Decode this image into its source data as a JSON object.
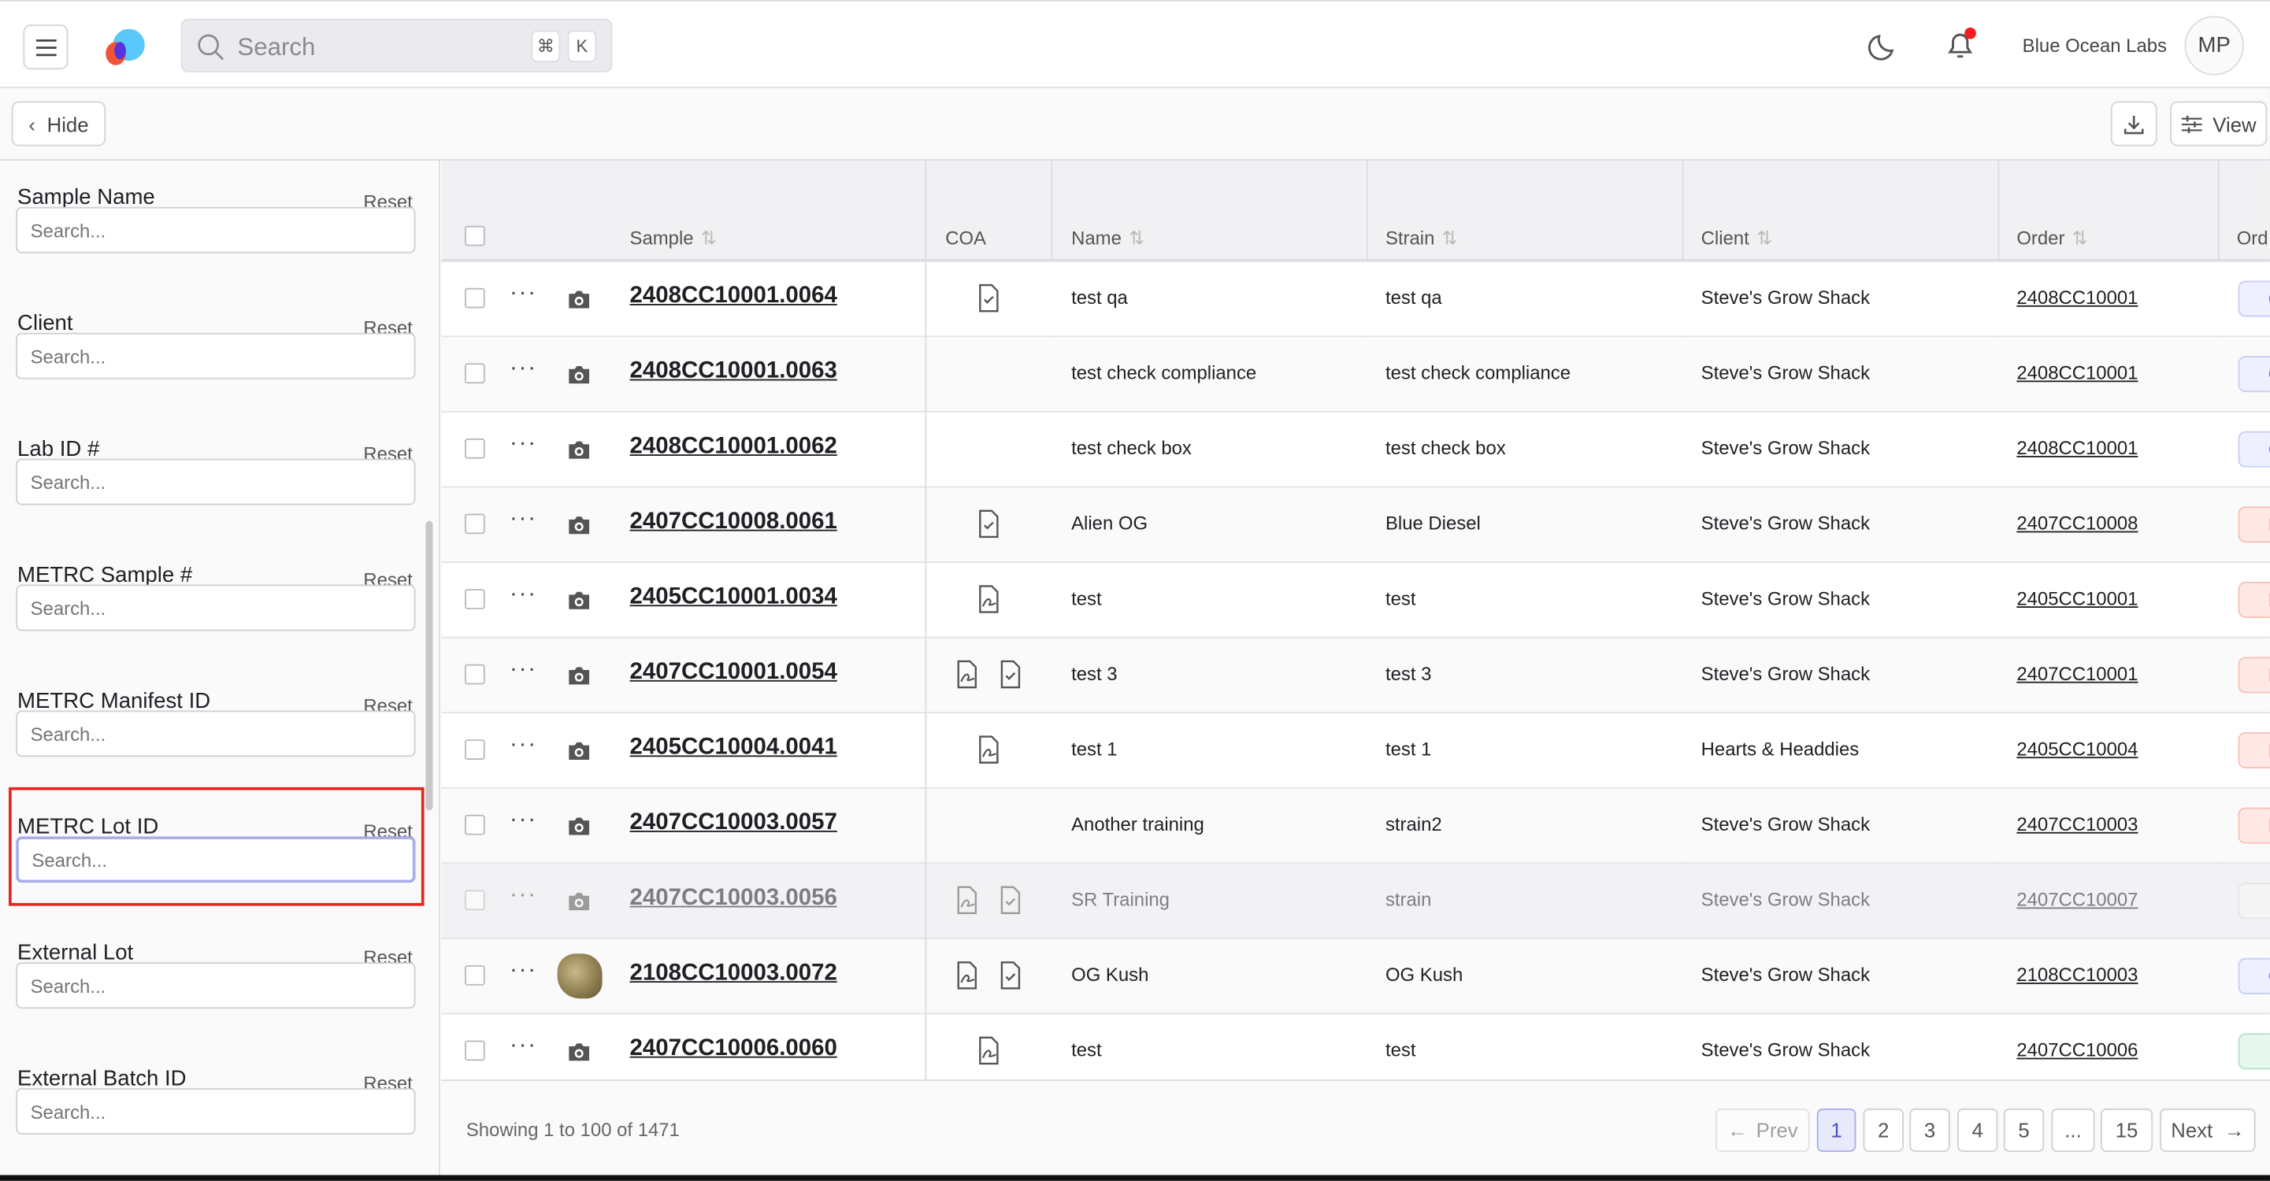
{
  "header": {
    "search_placeholder": "Search",
    "kbd_cmd": "⌘",
    "kbd_k": "K",
    "org_name": "Blue Ocean Labs",
    "avatar_initials": "MP",
    "notification_dot_color": "#f01e1e"
  },
  "toolbar": {
    "hide_label": "Hide",
    "view_label": "View"
  },
  "filters": [
    {
      "label": "Sample Name",
      "reset": "Reset",
      "placeholder": "Search..."
    },
    {
      "label": "Client",
      "reset": "Reset",
      "placeholder": "Search..."
    },
    {
      "label": "Lab ID #",
      "reset": "Reset",
      "placeholder": "Search..."
    },
    {
      "label": "METRC Sample #",
      "reset": "Reset",
      "placeholder": "Search..."
    },
    {
      "label": "METRC Manifest ID",
      "reset": "Reset",
      "placeholder": "Search..."
    },
    {
      "label": "METRC Lot ID",
      "reset": "Reset",
      "placeholder": "Search...",
      "focused": true,
      "highlighted": true
    },
    {
      "label": "External Lot",
      "reset": "Reset",
      "placeholder": "Search..."
    },
    {
      "label": "External Batch ID",
      "reset": "Reset",
      "placeholder": "Search..."
    }
  ],
  "table": {
    "columns": {
      "sample": "Sample",
      "coa": "COA",
      "name": "Name",
      "strain": "Strain",
      "client": "Client",
      "order": "Order",
      "order_status": "Ord"
    },
    "rows": [
      {
        "sample": "2408CC10001.0064",
        "coa": [
          "check"
        ],
        "name": "test qa",
        "strain": "test qa",
        "client": "Steve's Grow Shack",
        "order": "2408CC10001",
        "status": "blue",
        "status_text": "C"
      },
      {
        "sample": "2408CC10001.0063",
        "coa": [],
        "name": "test check compliance",
        "strain": "test check compliance",
        "client": "Steve's Grow Shack",
        "order": "2408CC10001",
        "status": "blue",
        "status_text": "C"
      },
      {
        "sample": "2408CC10001.0062",
        "coa": [],
        "name": "test check box",
        "strain": "test check box",
        "client": "Steve's Grow Shack",
        "order": "2408CC10001",
        "status": "blue",
        "status_text": "C"
      },
      {
        "sample": "2407CC10008.0061",
        "coa": [
          "check"
        ],
        "name": "Alien OG",
        "strain": "Blue Diesel",
        "client": "Steve's Grow Shack",
        "order": "2407CC10008",
        "status": "red",
        "status_text": "I"
      },
      {
        "sample": "2405CC10001.0034",
        "coa": [
          "sign"
        ],
        "name": "test",
        "strain": "test",
        "client": "Steve's Grow Shack",
        "order": "2405CC10001",
        "status": "red",
        "status_text": "I"
      },
      {
        "sample": "2407CC10001.0054",
        "coa": [
          "sign",
          "check"
        ],
        "name": "test 3",
        "strain": "test 3",
        "client": "Steve's Grow Shack",
        "order": "2407CC10001",
        "status": "red",
        "status_text": "I"
      },
      {
        "sample": "2405CC10004.0041",
        "coa": [
          "sign"
        ],
        "name": "test 1",
        "strain": "test 1",
        "client": "Hearts & Headdies",
        "order": "2405CC10004",
        "status": "red",
        "status_text": "I"
      },
      {
        "sample": "2407CC10003.0057",
        "coa": [],
        "name": "Another training",
        "strain": "strain2",
        "client": "Steve's Grow Shack",
        "order": "2407CC10003",
        "status": "red",
        "status_text": "I"
      },
      {
        "sample": "2407CC10003.0056",
        "coa": [
          "sign",
          "check"
        ],
        "name": "SR Training",
        "strain": "strain",
        "client": "Steve's Grow Shack",
        "order": "2407CC10007",
        "status": "grey",
        "status_text": "",
        "disabled": true
      },
      {
        "sample": "2108CC10003.0072",
        "coa": [
          "sign",
          "check"
        ],
        "name": "OG Kush",
        "strain": "OG Kush",
        "client": "Steve's Grow Shack",
        "order": "2108CC10003",
        "status": "blue",
        "status_text": "C",
        "thumbnail": true
      },
      {
        "sample": "2407CC10006.0060",
        "coa": [
          "sign"
        ],
        "name": "test",
        "strain": "test",
        "client": "Steve's Grow Shack",
        "order": "2407CC10006",
        "status": "green",
        "status_text": ""
      }
    ]
  },
  "footer": {
    "showing": "Showing 1 to 100 of 1471",
    "prev": "Prev",
    "next": "Next",
    "pages": [
      "1",
      "2",
      "3",
      "4",
      "5",
      "...",
      "15"
    ],
    "current_page": "1"
  },
  "colors": {
    "badge_blue": "#eef0ff",
    "badge_red": "#ffe9e6",
    "badge_green": "#e6f7ee",
    "focus_highlight": "#e3261e"
  }
}
